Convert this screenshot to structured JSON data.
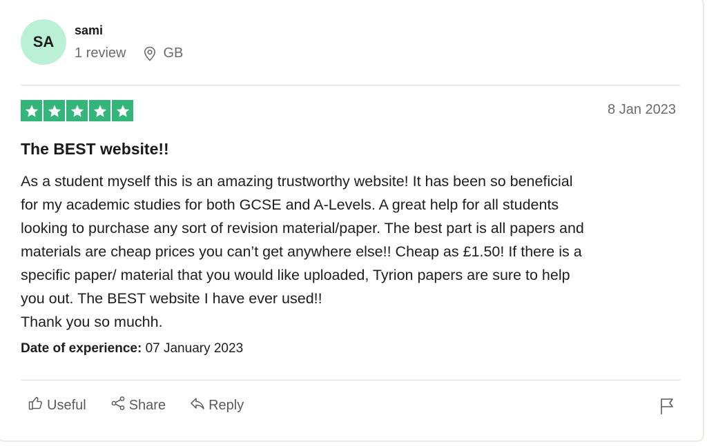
{
  "reviewer": {
    "initials": "SA",
    "name": "sami",
    "review_count": "1 review",
    "country": "GB"
  },
  "review": {
    "rating": 5,
    "date": "8 Jan 2023",
    "title": "The BEST website!!",
    "body_lines": [
      "As a student myself this is an amazing trustworthy website! It has been so beneficial",
      "for my academic studies for both GCSE and A-Levels. A great help for all students",
      "looking to purchase any sort of revision material/paper. The best part is all papers and",
      "materials are cheap prices you can’t get anywhere else!! Cheap as £1.50! If there is a",
      "specific paper/ material that you would like uploaded, Tyrion papers are sure to help",
      "you out. The BEST website I have ever used!!",
      "Thank you so muchh."
    ],
    "experience_label": "Date of experience:",
    "experience_date": "07 January 2023"
  },
  "actions": {
    "useful": "Useful",
    "share": "Share",
    "reply": "Reply"
  },
  "icons": {
    "location": "location-pin-icon",
    "star": "star-icon",
    "useful": "thumbs-up-icon",
    "share": "share-icon",
    "reply": "reply-icon",
    "report": "flag-icon"
  },
  "colors": {
    "star_green": "#34b67a",
    "avatar_bg": "#b9f0d6"
  }
}
